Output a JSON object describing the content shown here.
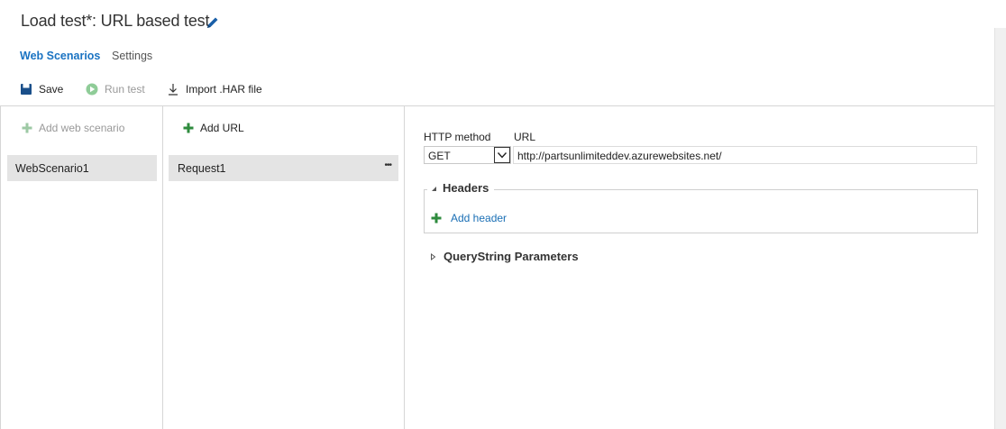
{
  "header": {
    "title": "Load test*: URL based test",
    "edit_icon": "pencil-icon"
  },
  "tabs": [
    {
      "label": "Web Scenarios",
      "active": true
    },
    {
      "label": "Settings",
      "active": false
    }
  ],
  "toolbar": {
    "save_label": "Save",
    "run_test_label": "Run test",
    "import_label": "Import .HAR file"
  },
  "scenarios": {
    "add_label": "Add web scenario",
    "items": [
      {
        "label": "WebScenario1",
        "selected": true
      }
    ]
  },
  "requests": {
    "add_label": "Add URL",
    "items": [
      {
        "label": "Request1",
        "selected": true,
        "more": "•••"
      }
    ]
  },
  "detail": {
    "http_method_label": "HTTP method",
    "http_method_value": "GET",
    "url_label": "URL",
    "url_value": "http://partsunlimiteddev.azurewebsites.net/",
    "headers_title": "Headers",
    "add_header_label": "Add header",
    "querystring_title": "QueryString Parameters"
  },
  "colors": {
    "accent": "#1a73c2",
    "add_green": "#2e8b3d",
    "selected_bg": "#e4e4e4"
  }
}
